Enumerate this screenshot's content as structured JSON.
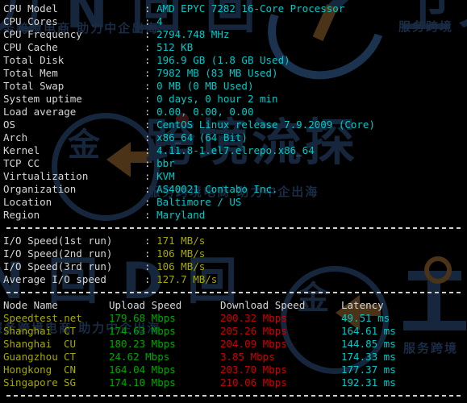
{
  "colors": {
    "background": "#000000",
    "label": "#d6d6d6",
    "value_cyan": "#00c8c8",
    "value_yellow": "#a6a600",
    "upload_green": "#00a600",
    "download_red": "#cc0000",
    "latency_cyan": "#00c8c8",
    "watermark_blue": "#16273d"
  },
  "system_info": {
    "rows": [
      {
        "label": "CPU Model",
        "value": "AMD EPYC 7282 16-Core Processor"
      },
      {
        "label": "CPU Cores",
        "value": "4"
      },
      {
        "label": "CPU Frequency",
        "value": "2794.748 MHz"
      },
      {
        "label": "CPU Cache",
        "value": "512 KB"
      },
      {
        "label": "Total Disk",
        "value": "196.9 GB (1.8 GB Used)"
      },
      {
        "label": "Total Mem",
        "value": "7982 MB (83 MB Used)"
      },
      {
        "label": "Total Swap",
        "value": "0 MB (0 MB Used)"
      },
      {
        "label": "System uptime",
        "value": "0 days, 0 hour 2 min"
      },
      {
        "label": "Load average",
        "value": "0.00, 0.00, 0.00"
      },
      {
        "label": "OS",
        "value": "CentOS Linux release 7.9.2009 (Core)"
      },
      {
        "label": "Arch",
        "value": "x86_64 (64 Bit)"
      },
      {
        "label": "Kernel",
        "value": "4.11.8-1.el7.elrepo.x86_64"
      },
      {
        "label": "TCP CC",
        "value": "bbr"
      },
      {
        "label": "Virtualization",
        "value": "KVM"
      },
      {
        "label": "Organization",
        "value": "AS40021 Contabo Inc."
      },
      {
        "label": "Location",
        "value": "Baltimore / US"
      },
      {
        "label": "Region",
        "value": "Maryland"
      }
    ]
  },
  "io_speed": {
    "rows": [
      {
        "label": "I/O Speed(1st run)",
        "value": "171 MB/s"
      },
      {
        "label": "I/O Speed(2nd run)",
        "value": "106 MB/s"
      },
      {
        "label": "I/O Speed(3rd run)",
        "value": "106 MB/s"
      },
      {
        "label": "Average I/O speed",
        "value": "127.7 MB/s"
      }
    ]
  },
  "speedtest": {
    "headers": {
      "node": "Node Name",
      "isp": "",
      "upload": "Upload Speed",
      "download": "Download Speed",
      "latency": "Latency"
    },
    "rows": [
      {
        "node": "Speedtest.net",
        "isp": "",
        "upload": "179.68 Mbps",
        "download": "200.32 Mbps",
        "latency": "49.51 ms"
      },
      {
        "node": "Shanghai",
        "isp": "CT",
        "upload": "174.63 Mbps",
        "download": "205.26 Mbps",
        "latency": "164.61 ms"
      },
      {
        "node": "Shanghai",
        "isp": "CU",
        "upload": "180.23 Mbps",
        "download": "204.09 Mbps",
        "latency": "144.85 ms"
      },
      {
        "node": "Guangzhou",
        "isp": "CT",
        "upload": "24.62 Mbps",
        "download": "3.85 Mbps",
        "latency": "174.33 ms"
      },
      {
        "node": "Hongkong",
        "isp": "CN",
        "upload": "164.04 Mbps",
        "download": "203.70 Mbps",
        "latency": "177.37 ms"
      },
      {
        "node": "Singapore",
        "isp": "SG",
        "upload": "174.10 Mbps",
        "download": "210.06 Mbps",
        "latency": "192.31 ms"
      }
    ]
  },
  "watermarks": {
    "top_left_cn": "服务跨境电商 助力中企出海",
    "top_right_cn": "服务跨境",
    "mid_cn": "服务跨境电商 助力中企出海",
    "bottom_right_cn": "服务跨境",
    "separator_char": ":"
  }
}
